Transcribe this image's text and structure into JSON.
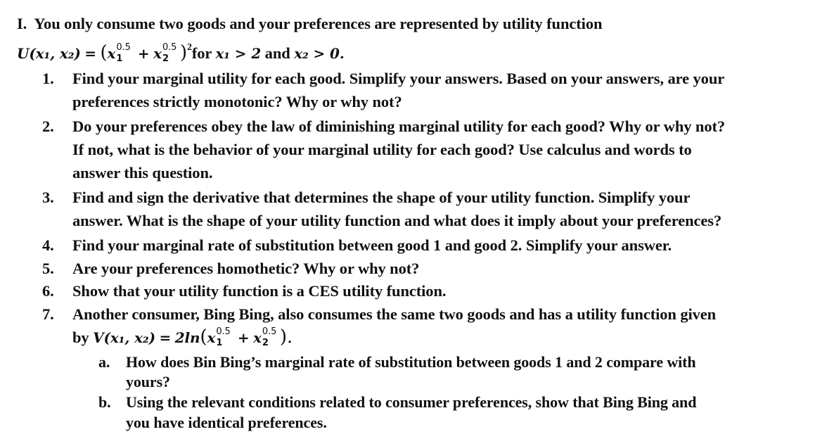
{
  "problem": {
    "number": "I.",
    "intro": "You only consume two goods and your preferences are represented by utility function",
    "utility_function": {
      "lhs": "U(x₁, x₂)",
      "equals": "=",
      "term1_base": "x",
      "term1_exp": "0.5",
      "term1_sub": "1",
      "plus": "+",
      "term2_base": "x",
      "term2_exp": "0.5",
      "term2_sub": "2",
      "outer_exp": "2",
      "condition_text": "for",
      "condition1": "x₁ > 2",
      "and_text": "and",
      "condition2": "x₂ > 0."
    }
  },
  "questions": [
    {
      "number": "1.",
      "lines": [
        "Find your marginal utility for each good. Simplify your answers. Based on your answers, are your",
        "preferences strictly monotonic? Why or why not?"
      ]
    },
    {
      "number": "2.",
      "lines": [
        "Do your preferences obey the law of diminishing marginal utility for each good? Why or why not?",
        "If not, what is the behavior of your marginal utility for each good? Use calculus and words to",
        "answer this question."
      ]
    },
    {
      "number": "3.",
      "lines": [
        "Find and sign the derivative that determines the shape of your utility function. Simplify your",
        "answer. What is the shape of your utility function and what does it imply about your preferences?"
      ]
    },
    {
      "number": "4.",
      "lines": [
        "Find your marginal rate of substitution between good 1 and good 2. Simplify your answer."
      ]
    },
    {
      "number": "5.",
      "lines": [
        "Are your preferences homothetic? Why or why not?"
      ]
    },
    {
      "number": "6.",
      "lines": [
        "Show that your utility function is a CES utility function."
      ]
    },
    {
      "number": "7.",
      "lines": [
        "Another consumer, Bing Bing, also consumes the same two goods and has a utility function given"
      ],
      "formula": {
        "prefix": "by",
        "lhs": "V(x₁, x₂)",
        "equals": "=",
        "coef": "2ln",
        "term1_base": "x",
        "term1_exp": "0.5",
        "term1_sub": "1",
        "plus": "+",
        "term2_base": "x",
        "term2_exp": "0.5",
        "term2_sub": "2",
        "end": ")."
      }
    }
  ],
  "subquestions": [
    {
      "letter": "a.",
      "lines": [
        "How does Bin Bing’s marginal rate of substitution between goods 1 and 2 compare with",
        "yours?"
      ]
    },
    {
      "letter": "b.",
      "lines": [
        "Using the relevant conditions related to consumer preferences, show that Bing Bing and",
        "you have identical preferences."
      ]
    }
  ]
}
